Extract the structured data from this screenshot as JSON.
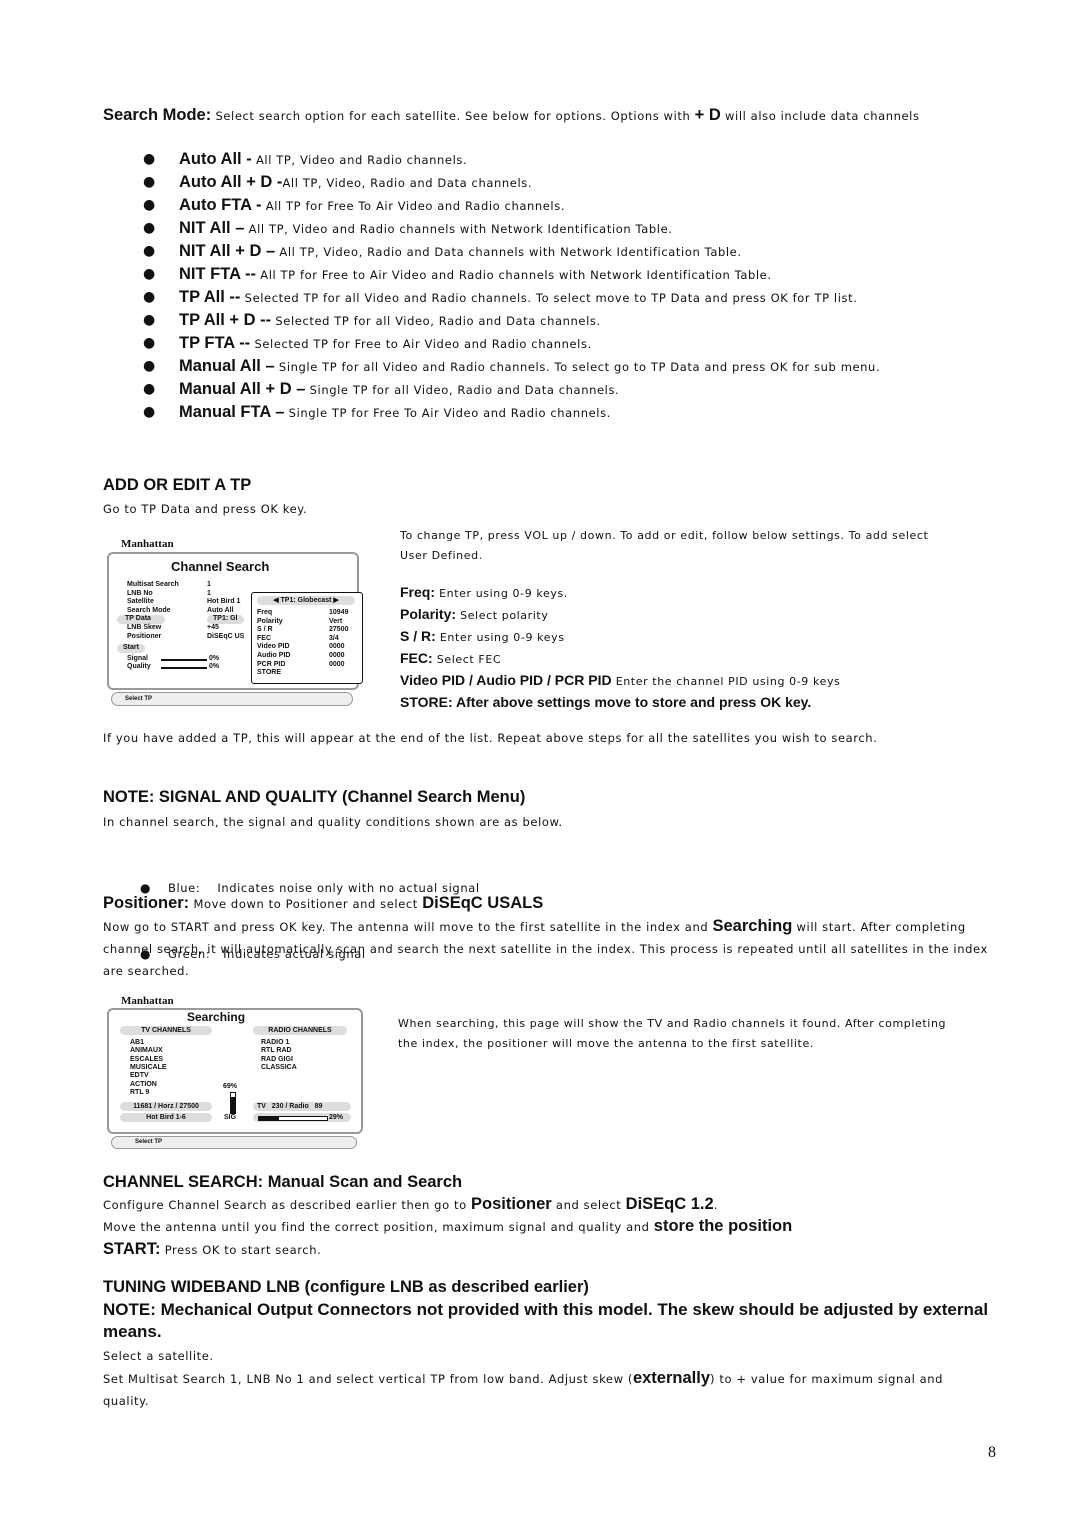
{
  "search_mode": [
    [
      "b",
      "Search Mode:"
    ],
    [
      "t",
      " Select search option for each satellite. See below for options. Options with "
    ],
    [
      "b",
      "+ D"
    ],
    [
      "t",
      " will also include data channels"
    ]
  ],
  "search_options": [
    {
      "term": "Auto All -",
      "desc": " All TP, Video and Radio channels."
    },
    {
      "term": "Auto All + D -",
      "desc": "All TP, Video, Radio and Data channels."
    },
    {
      "term": "Auto FTA -",
      "desc": " All TP for Free To Air Video and Radio channels."
    },
    {
      "term": "NIT All –",
      "desc": " All TP, Video and Radio channels with Network Identification Table."
    },
    {
      "term": "NIT All + D –",
      "desc": " All TP, Video, Radio and Data channels with Network Identification Table."
    },
    {
      "term": "NIT FTA --",
      "desc": " All TP for Free to Air Video and Radio channels with Network Identification Table."
    },
    {
      "term": "TP All --",
      "desc": " Selected TP for all Video and Radio channels. To select move to TP Data and press OK for TP list."
    },
    {
      "term": "TP All + D --",
      "desc": " Selected TP for all Video, Radio and Data channels."
    },
    {
      "term": "TP FTA --",
      "desc": " Selected TP for Free to Air Video and Radio channels."
    },
    {
      "term": "Manual All –",
      "desc": " Single TP for all Video and Radio channels. To select go to TP Data and press OK for sub menu."
    },
    {
      "term": "Manual All + D –",
      "desc": " Single TP for all Video, Radio and Data channels."
    },
    {
      "term": "Manual FTA –",
      "desc": " Single TP for Free To Air Video and Radio channels."
    }
  ],
  "add_tp": {
    "heading": "ADD OR EDIT A TP",
    "intro": "Go to TP Data and press OK key.",
    "side": [
      [
        [
          "t",
          "To change TP, press VOL up / down. To add or edit, follow below settings. To add select User Defined."
        ]
      ],
      [
        [
          "b",
          "Freq:"
        ],
        [
          "t",
          " Enter using 0-9 keys."
        ]
      ],
      [
        [
          "b",
          "Polarity:"
        ],
        [
          "t",
          " Select polarity"
        ]
      ],
      [
        [
          "b",
          "S / R:"
        ],
        [
          "t",
          " Enter using 0-9 keys"
        ]
      ],
      [
        [
          "b",
          "FEC:"
        ],
        [
          "t",
          " Select FEC"
        ]
      ],
      [
        [
          "b",
          "Video PID / Audio PID / PCR PID"
        ],
        [
          "t",
          " Enter the channel PID using 0-9 keys"
        ]
      ],
      [
        [
          "b",
          "STORE: After above settings move to store and press OK key."
        ]
      ]
    ],
    "after": "If you have added a TP, this will appear at the end of the list. Repeat above steps for all the satellites you wish to search."
  },
  "screen1": {
    "brand": "Manhattan",
    "title": "Channel Search",
    "rows": [
      [
        "Multisat Search",
        "1"
      ],
      [
        "LNB No",
        "1"
      ],
      [
        "Satellite",
        "Hot Bird 1"
      ],
      [
        "Search Mode",
        "Auto All"
      ],
      [
        "TP Data",
        "TP1: Gl"
      ],
      [
        "LNB Skew",
        "+45"
      ],
      [
        "Positioner",
        "DiSEqC US"
      ]
    ],
    "start": "Start",
    "signal": "Signal",
    "quality": "Quality",
    "signal_val": "0%",
    "quality_val": "0%",
    "tp_name": "TP1: Globecast",
    "tp_rows": [
      [
        "Freq",
        "10949"
      ],
      [
        "Polarity",
        "Vert"
      ],
      [
        "S / R",
        "27500"
      ],
      [
        "FEC",
        "3/4"
      ],
      [
        "Video PID",
        "0000"
      ],
      [
        "Audio PID",
        "0000"
      ],
      [
        "PCR PID",
        "0000"
      ],
      [
        "STORE",
        ""
      ]
    ],
    "help": "Select TP"
  },
  "note_sq": {
    "heading": "NOTE: SIGNAL AND QUALITY (Channel Search Menu)",
    "intro": "In channel search, the signal and quality conditions shown are as below.",
    "items": [
      "Blue:    Indicates noise only with no actual signal",
      "Green:   Indicates actual signal"
    ]
  },
  "positioner": [
    [
      "b",
      "Positioner:"
    ],
    [
      "t",
      " Move down to Positioner and select "
    ],
    [
      "b",
      "DiSEqC USALS"
    ]
  ],
  "positioner_text": [
    [
      "t",
      "Now go to START and press OK key. The antenna will move to the first satellite in the index and "
    ],
    [
      "b",
      "Searching"
    ],
    [
      "t",
      " will start. After completing channel search, it will automatically scan and search the next satellite in the index. This process is repeated until all satellites in the index are searched."
    ]
  ],
  "screen2": {
    "brand": "Manhattan",
    "title": "Searching",
    "tv_header": "TV CHANNELS",
    "radio_header": "RADIO CHANNELS",
    "tv": [
      "AB1",
      "ANIMAUX",
      "ESCALES",
      "MUSICALE",
      "EDTV",
      "ACTION",
      "RTL 9"
    ],
    "radio": [
      "RADIO 1",
      "RTL RAD",
      "RAD GIGI",
      "CLASSICA"
    ],
    "tp": "11681 / Horz / 27500",
    "sat": "Hot Bird 1-6",
    "sig_pct": "69%",
    "sig_label": "SIG",
    "counts": "TV   230 / Radio   89",
    "bar_pct": "29%",
    "bar_fill": 0.29,
    "help": "Select TP"
  },
  "searching_text": "When searching, this page will show the TV and Radio channels it found. After completing the index, the positioner will move the antenna to the first satellite.",
  "manual": {
    "heading": "CHANNEL SEARCH: Manual Scan and Search",
    "l1": [
      [
        "t",
        "Configure Channel Search as described earlier then go to "
      ],
      [
        "b",
        "Positioner"
      ],
      [
        "t",
        " and select "
      ],
      [
        "b",
        "DiSEqC 1.2"
      ],
      [
        "t",
        "."
      ]
    ],
    "l2": [
      [
        "t",
        "Move the antenna until you find the correct position, maximum signal and quality and "
      ],
      [
        "b",
        "store the position"
      ]
    ],
    "l3": [
      [
        "b",
        "START:"
      ],
      [
        "t",
        " Press OK to start search."
      ]
    ]
  },
  "tuning": {
    "heading": "TUNING WIDEBAND LNB (configure LNB as described earlier)",
    "note": "NOTE: Mechanical Output Connectors not provided with this model. The skew should be adjusted by external means.",
    "l1": "Select a satellite.",
    "l2": [
      [
        "t",
        "Set Multisat Search 1, LNB No 1 and select vertical TP from low band. Adjust skew ("
      ],
      [
        "b",
        "externally"
      ],
      [
        "t",
        ") to + value for maximum signal and quality."
      ]
    ]
  },
  "page_number": "8",
  "colors": {
    "text": "#111111",
    "screen_border": "#999999",
    "pill": "#dddddd"
  }
}
